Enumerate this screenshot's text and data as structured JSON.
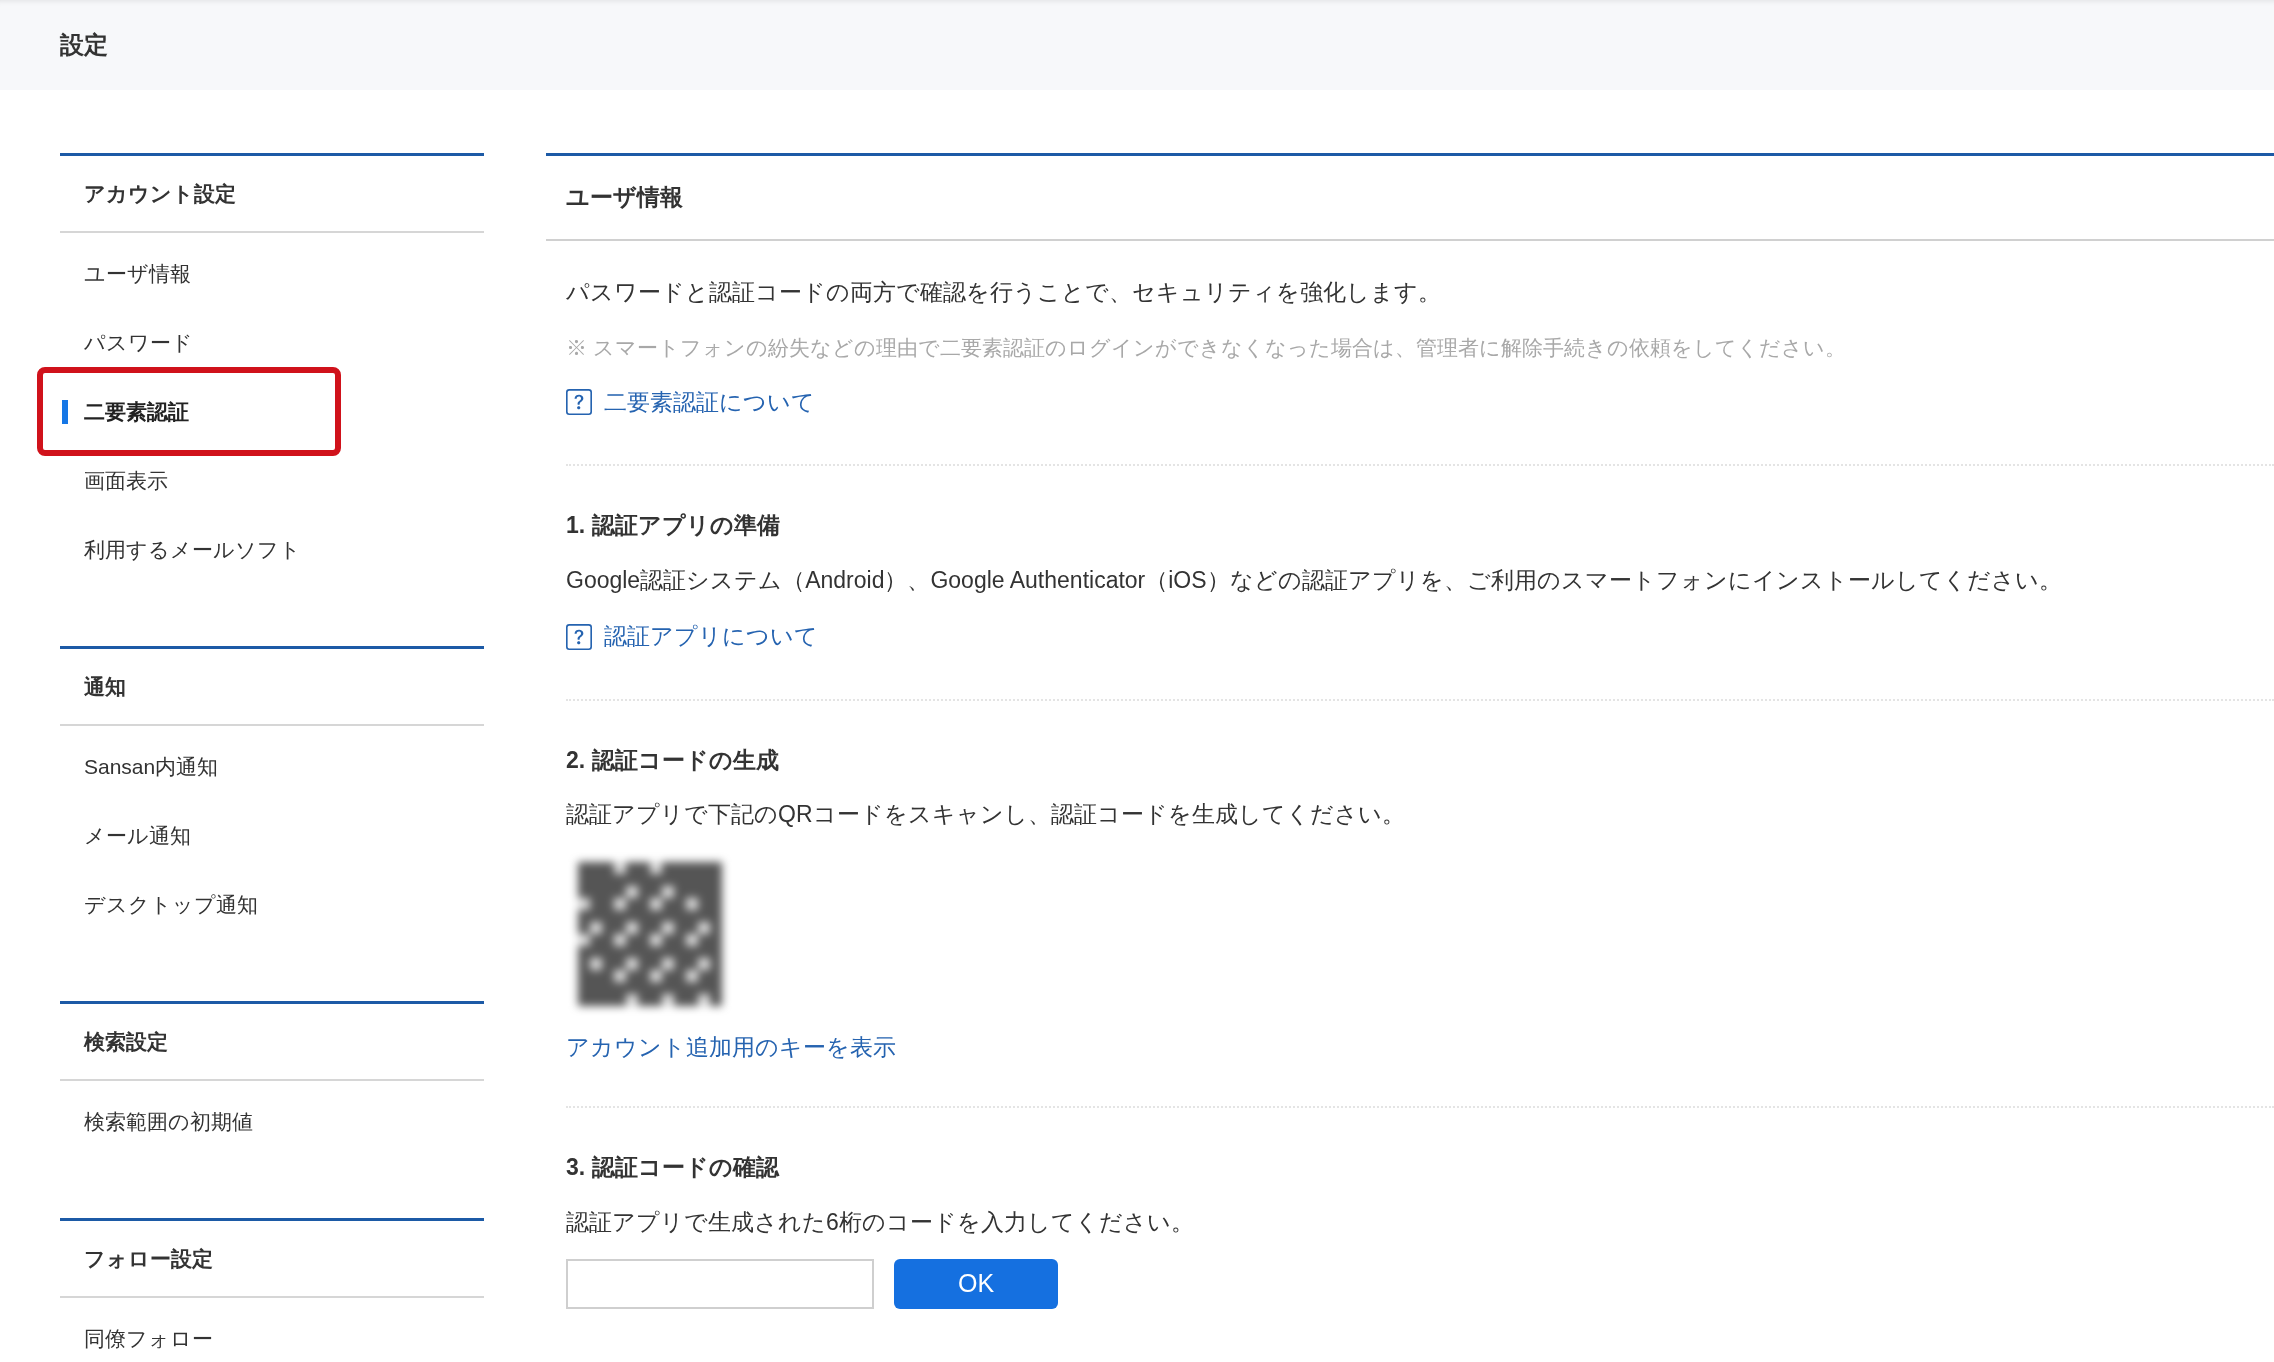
{
  "header": {
    "title": "設定"
  },
  "sidebar": {
    "sections": [
      {
        "title": "アカウント設定",
        "items": [
          {
            "label": "ユーザ情報",
            "selected": false,
            "highlighted": false
          },
          {
            "label": "パスワード",
            "selected": false,
            "highlighted": false
          },
          {
            "label": "二要素認証",
            "selected": true,
            "highlighted": true
          },
          {
            "label": "画面表示",
            "selected": false,
            "highlighted": false
          },
          {
            "label": "利用するメールソフト",
            "selected": false,
            "highlighted": false
          }
        ]
      },
      {
        "title": "通知",
        "items": [
          {
            "label": "Sansan内通知",
            "selected": false,
            "highlighted": false
          },
          {
            "label": "メール通知",
            "selected": false,
            "highlighted": false
          },
          {
            "label": "デスクトップ通知",
            "selected": false,
            "highlighted": false
          }
        ]
      },
      {
        "title": "検索設定",
        "items": [
          {
            "label": "検索範囲の初期値",
            "selected": false,
            "highlighted": false
          }
        ]
      },
      {
        "title": "フォロー設定",
        "items": [
          {
            "label": "同僚フォロー",
            "selected": false,
            "highlighted": false
          }
        ]
      }
    ]
  },
  "content": {
    "title": "ユーザ情報",
    "intro": "パスワードと認証コードの両方で確認を行うことで、セキュリティを強化します。",
    "note": "※ スマートフォンの紛失などの理由で二要素認証のログインができなくなった場合は、管理者に解除手続きの依頼をしてください。",
    "help_link": "二要素認証について",
    "steps": [
      {
        "kind": "help",
        "heading": "1. 認証アプリの準備",
        "text": "Google認証システム（Android）、Google Authenticator（iOS）などの認証アプリを、ご利用のスマートフォンにインストールしてください。",
        "link": "認証アプリについて"
      },
      {
        "kind": "qr",
        "heading": "2. 認証コードの生成",
        "text": "認証アプリで下記のQRコードをスキャンし、認証コードを生成してください。",
        "link": "アカウント追加用のキーを表示"
      },
      {
        "kind": "code_input",
        "heading": "3. 認証コードの確認",
        "text": "認証アプリで生成された6桁のコードを入力してください。",
        "button": "OK"
      }
    ]
  }
}
